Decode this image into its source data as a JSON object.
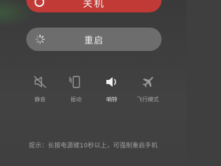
{
  "power_menu": {
    "power_off": {
      "label": "关机",
      "icon": "power-icon",
      "color": "#c23a36"
    },
    "restart": {
      "label": "重启",
      "icon": "loading-spinner-icon",
      "color": "#6d6d6d"
    }
  },
  "toggles": [
    {
      "label": "静音",
      "icon": "mute-icon",
      "active": false
    },
    {
      "label": "振动",
      "icon": "vibrate-icon",
      "active": false
    },
    {
      "label": "响铃",
      "icon": "ring-icon",
      "active": true
    },
    {
      "label": "飞行模式",
      "icon": "airplane-icon",
      "active": false
    }
  ],
  "hint": "提示：长按电源键10秒以上，可强制重启手机"
}
